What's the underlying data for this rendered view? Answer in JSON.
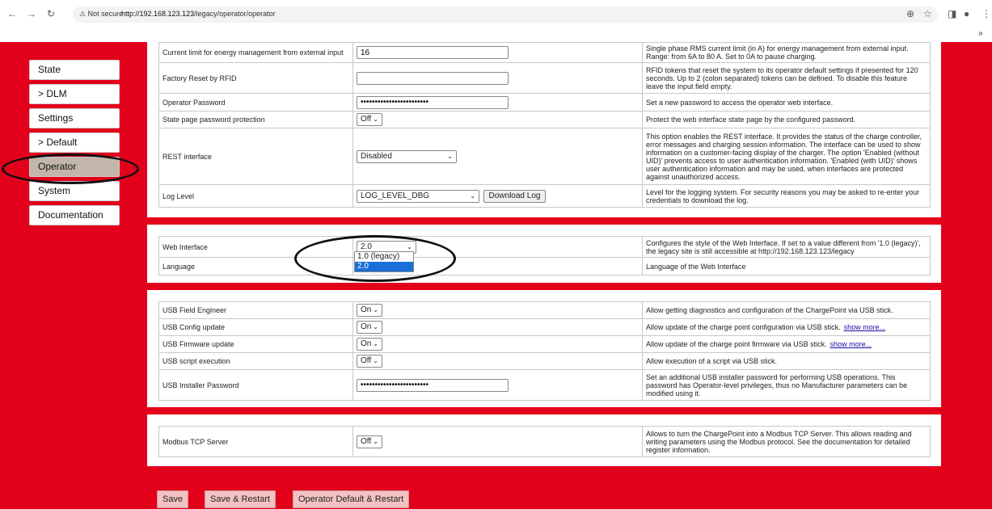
{
  "browser": {
    "security": "Not secure",
    "url_host": "http://192.168.123.123",
    "url_path": "/legacy/operator/operator",
    "ext_chevron": "»"
  },
  "sidebar": {
    "items": [
      {
        "label": "State"
      },
      {
        "label": "> DLM"
      },
      {
        "label": "Settings"
      },
      {
        "label": "> Default"
      },
      {
        "label": "Operator",
        "active": true
      },
      {
        "label": "System"
      },
      {
        "label": "Documentation"
      }
    ]
  },
  "panel1": {
    "rows": [
      {
        "label": "Current limit for energy management from external input",
        "value": "16",
        "desc": "Single phase RMS current limit (in A) for energy management from external input. Range: from 6A to 80 A. Set to 0A to pause charging."
      },
      {
        "label": "Factory Reset by RFID",
        "value": "",
        "desc": "RFID tokens that reset the system to its operator default settings if presented for 120 seconds. Up to 2 (colon separated) tokens can be defined. To disable this feature leave the input field empty."
      },
      {
        "label": "Operator Password",
        "value": "••••••••••••••••••••••••",
        "desc": "Set a new password to access the operator web interface."
      },
      {
        "label": "State page password protection",
        "value": "Off",
        "desc": "Protect the web interface state page by the configured password."
      },
      {
        "label": "REST interface",
        "value": "Disabled",
        "desc": "This option enables the REST interface. It provides the status of the charge controller, error messages and charging session information. The interface can be used to show information on a customer-facing display of the charger. The option 'Enabled (without UID)' prevents access to user authentication information. 'Enabled (with UID)' shows user authentication information and may be used, when interfaces are protected against unauthorized access."
      },
      {
        "label": "Log Level",
        "value": "LOG_LEVEL_DBG",
        "button": "Download Log",
        "desc": "Level for the logging system. For security reasons you may be asked to re-enter your credentials to download the log."
      }
    ]
  },
  "panel2": {
    "rows": [
      {
        "label": "Web Interface",
        "value": "2.0",
        "desc": "Configures the style of the Web Interface. If set to a value different from '1.0 (legacy)', the legacy site is still accessible at http://192.168.123.123/legacy"
      },
      {
        "label": "Language",
        "value": "",
        "desc": "Language of the Web Interface"
      }
    ],
    "dropdown_options": [
      "1.0 (legacy)",
      "2.0"
    ]
  },
  "panel3": {
    "rows": [
      {
        "label": "USB Field Engineer",
        "value": "On",
        "desc": "Allow getting diagnostics and configuration of the ChargePoint via USB stick."
      },
      {
        "label": "USB Config update",
        "value": "On",
        "desc": "Allow update of the charge point configuration via USB stick.",
        "link": "show more..."
      },
      {
        "label": "USB Firmware update",
        "value": "On",
        "desc": "Allow update of the charge point firmware via USB stick.",
        "link": "show more..."
      },
      {
        "label": "USB script execution",
        "value": "Off",
        "desc": "Allow execution of a script via USB stick."
      },
      {
        "label": "USB Installer Password",
        "value": "••••••••••••••••••••••••",
        "desc": "Set an additional USB installer password for performing USB operations. This password has Operator-level privileges, thus no Manufacturer parameters can be modified using it."
      }
    ]
  },
  "panel4": {
    "rows": [
      {
        "label": "Modbus TCP Server",
        "value": "Off",
        "desc": "Allows to turn the ChargePoint into a Modbus TCP Server. This allows reading and writing parameters using the Modbus protocol. See the documentation for detailed register information."
      }
    ]
  },
  "footer": {
    "save": "Save",
    "save_restart": "Save & Restart",
    "operator_default_restart": "Operator Default & Restart"
  },
  "colors": {
    "page_bg": "#e3001b",
    "active_item": "#c1b6a9",
    "dropdown_highlight": "#1a6ed8"
  }
}
